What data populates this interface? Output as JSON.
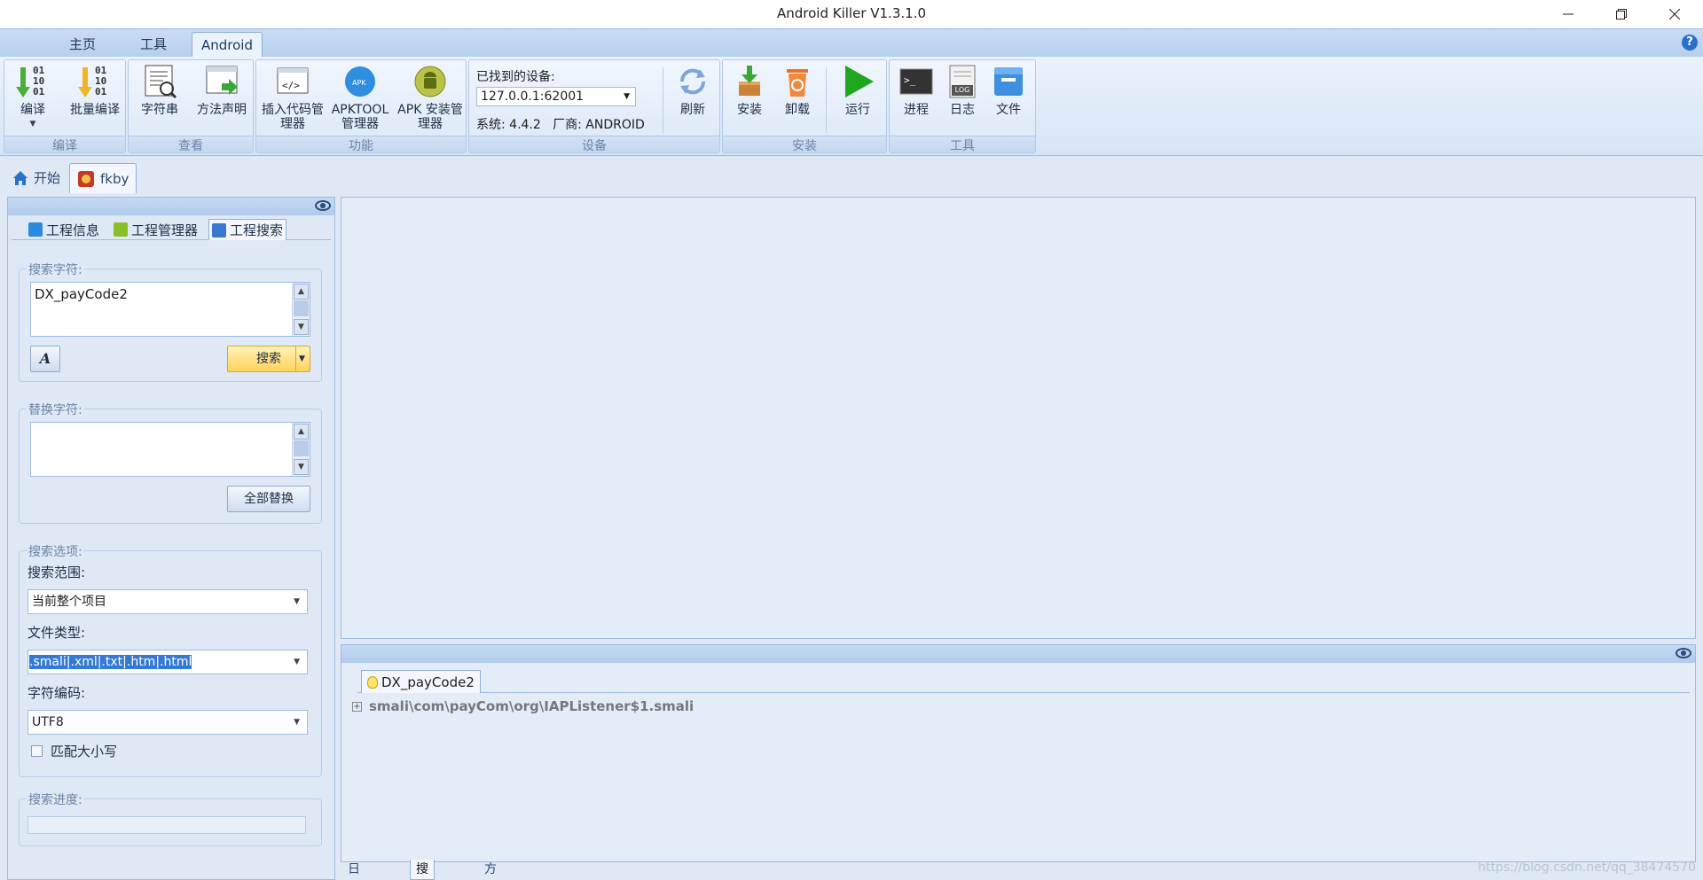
{
  "window": {
    "title": "Android Killer V1.3.1.0"
  },
  "ribbon_tabs": [
    "主页",
    "工具",
    "Android"
  ],
  "ribbon": {
    "groups": {
      "compile": "编译",
      "view": "查看",
      "function": "功能",
      "device": "设备",
      "install": "安装",
      "tools": "工具"
    },
    "buttons": {
      "compile": "编译",
      "batch_compile": "批量编译",
      "strings": "字符串",
      "method_desc": "方法声明",
      "insert_code": "插入代码管理器",
      "apktool": "APKTOOL管理器",
      "apk_install": "APK 安装管理器",
      "refresh": "刷新",
      "install": "安装",
      "uninstall": "卸载",
      "run": "运行",
      "process": "进程",
      "log": "日志",
      "file": "文件"
    },
    "device": {
      "label": "已找到的设备:",
      "selected": "127.0.0.1:62001",
      "info": "系统: 4.4.2   厂商: ANDROID"
    },
    "binary_digits": [
      "01",
      "10",
      "01"
    ],
    "log_badge": "LOG"
  },
  "doc_tabs": [
    "开始",
    "fkby"
  ],
  "left_panel": {
    "tabs": [
      "工程信息",
      "工程管理器",
      "工程搜索"
    ],
    "search_label": "搜索字符:",
    "search_value": "DX_payCode2",
    "font_button": "A",
    "search_button": "搜索",
    "replace_label": "替换字符:",
    "replace_value": "",
    "replace_all_button": "全部替换",
    "options_label": "搜索选项:",
    "scope_label": "搜索范围:",
    "scope_value": "当前整个项目",
    "filetype_label": "文件类型:",
    "filetype_value": ".smali|.xml|.txt|.htm|.html",
    "encoding_label": "字符编码:",
    "encoding_value": "UTF8",
    "match_case_label": "匹配大小写",
    "progress_label": "搜索进度:",
    "progress": 0
  },
  "results": {
    "tab": "DX_payCode2",
    "items": [
      "smali\\com\\payCom\\org\\IAPListener$1.smali"
    ]
  },
  "bottom_tabs": [
    "日志输出",
    "搜索结果",
    "方法引用"
  ],
  "watermark": "https://blog.csdn.net/qq_38474570",
  "colors": {
    "accent": "#3379d6",
    "ribbon": "#dbe8f7",
    "run": "#1fa61f"
  }
}
